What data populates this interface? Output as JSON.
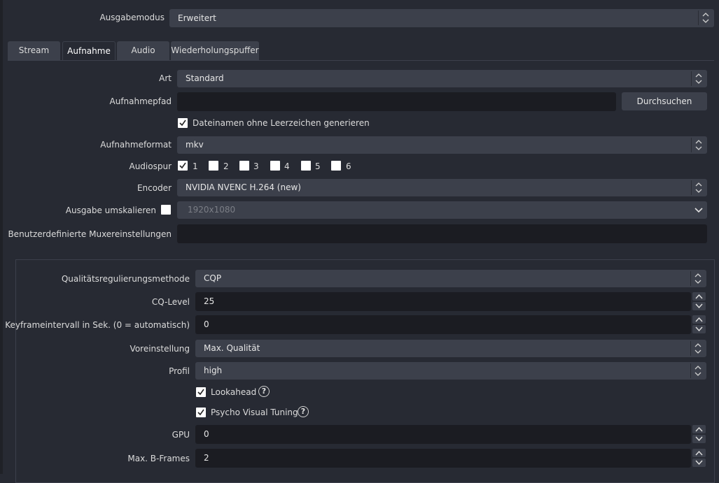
{
  "output_mode": {
    "label": "Ausgabemodus",
    "value": "Erweitert"
  },
  "tabs": [
    {
      "label": "Stream"
    },
    {
      "label": "Aufnahme"
    },
    {
      "label": "Audio"
    },
    {
      "label": "Wiederholungspuffer"
    }
  ],
  "recording": {
    "type": {
      "label": "Art",
      "value": "Standard"
    },
    "path": {
      "label": "Aufnahmepfad",
      "value": "",
      "browse_label": "Durchsuchen"
    },
    "no_space_filename": {
      "label": "Dateinamen ohne Leerzeichen generieren",
      "checked": true
    },
    "format": {
      "label": "Aufnahmeformat",
      "value": "mkv"
    },
    "audio_track": {
      "label": "Audiospur",
      "tracks": [
        {
          "label": "1",
          "checked": true
        },
        {
          "label": "2",
          "checked": false
        },
        {
          "label": "3",
          "checked": false
        },
        {
          "label": "4",
          "checked": false
        },
        {
          "label": "5",
          "checked": false
        },
        {
          "label": "6",
          "checked": false
        }
      ]
    },
    "encoder": {
      "label": "Encoder",
      "value": "NVIDIA NVENC H.264 (new)"
    },
    "rescale": {
      "label": "Ausgabe umskalieren",
      "checked": false,
      "value": "1920x1080"
    },
    "muxer": {
      "label": "Benutzerdefinierte Muxereinstellungen",
      "value": ""
    }
  },
  "encoder_settings": {
    "rate_control": {
      "label": "Qualitätsregulierungsmethode",
      "value": "CQP"
    },
    "cq_level": {
      "label": "CQ-Level",
      "value": "25"
    },
    "keyframe": {
      "label": "Keyframeintervall in Sek. (0 = automatisch)",
      "value": "0"
    },
    "preset": {
      "label": "Voreinstellung",
      "value": "Max. Qualität"
    },
    "profile": {
      "label": "Profil",
      "value": "high"
    },
    "lookahead": {
      "label": "Lookahead",
      "checked": true
    },
    "psycho_visual": {
      "label": "Psycho Visual Tuning",
      "checked": true
    },
    "gpu": {
      "label": "GPU",
      "value": "0"
    },
    "bframes": {
      "label": "Max. B-Frames",
      "value": "2"
    },
    "help_icon_text": "?"
  },
  "colors": {
    "background": "#272a33",
    "control": "#3c404b",
    "input": "#1b1c22",
    "text": "#dcdcdc"
  }
}
